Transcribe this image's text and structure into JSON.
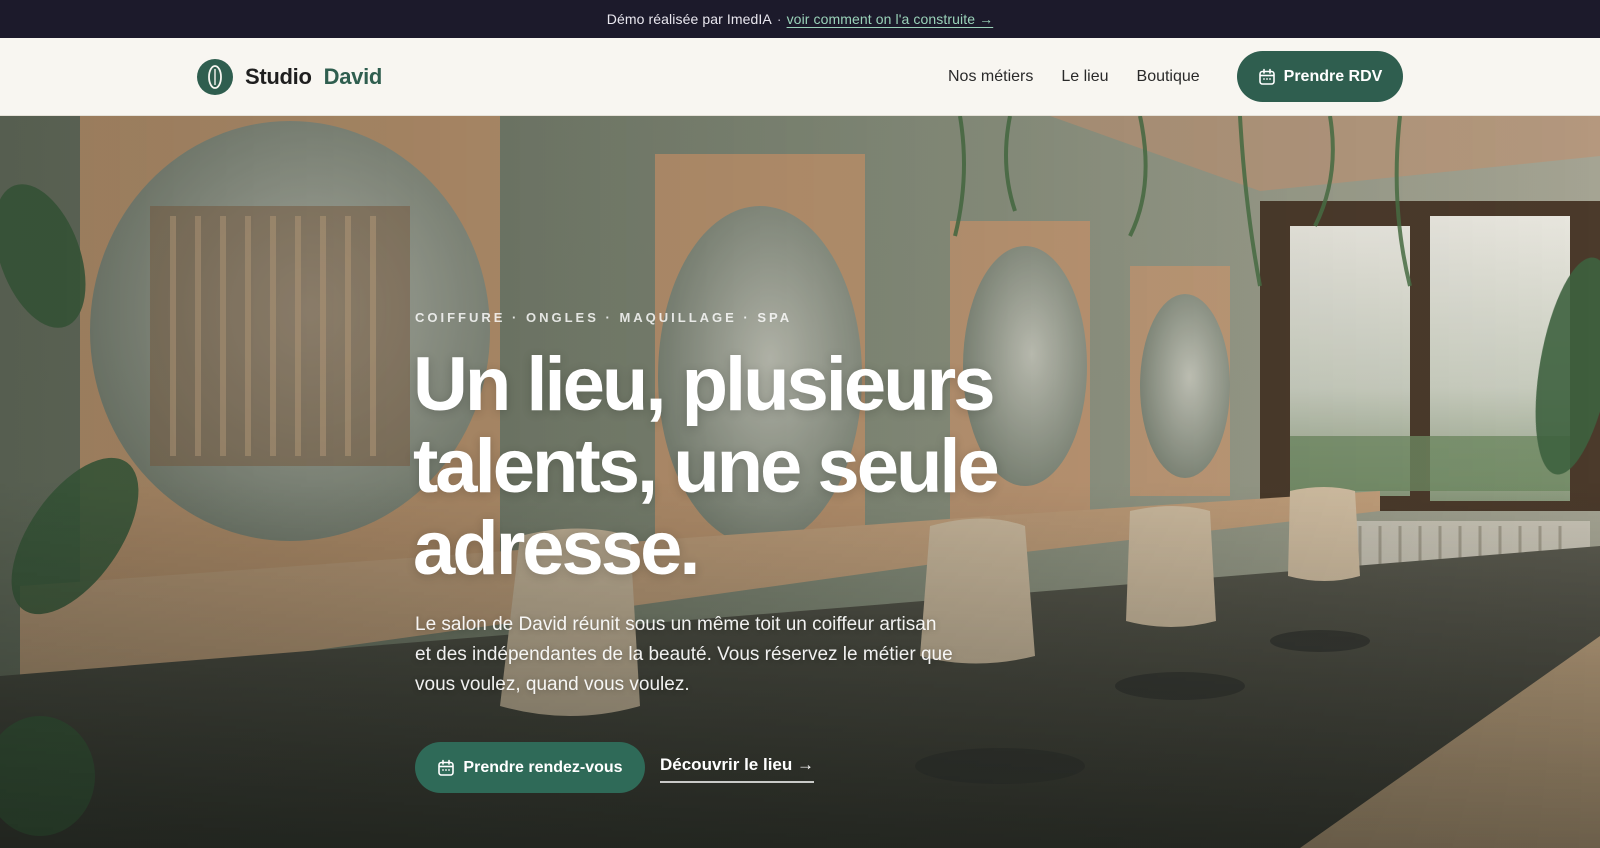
{
  "demo_banner": {
    "text": "Démo réalisée par ImedIA",
    "separator": "·",
    "link_label": "voir comment on l'a construite →"
  },
  "header": {
    "logo_icon": "leaf-icon",
    "brand_first": "Studio",
    "brand_second": "David",
    "nav": [
      "Nos métiers",
      "Le lieu",
      "Boutique"
    ],
    "cta_label": "Prendre RDV",
    "cta_icon": "calendar-icon"
  },
  "hero": {
    "eyebrow": "COIFFURE · ONGLES · MAQUILLAGE · SPA",
    "headline_lines": [
      "Un lieu, plusieurs",
      "talents, une seule",
      "adresse."
    ],
    "lead": "Le salon de David réunit sous un même toit un coiffeur artisan et des indépendantes de la beauté. Vous réservez le métier que vous voulez, quand vous voulez.",
    "primary_button": "Prendre rendez-vous",
    "primary_icon": "calendar-icon",
    "secondary_link": "Découvrir le lieu →"
  },
  "colors": {
    "brand_green": "#2f5e4f",
    "demo_bar": "#1c1a2b",
    "header_bg": "#f8f6f1",
    "link_teal": "#9ad2b9"
  }
}
